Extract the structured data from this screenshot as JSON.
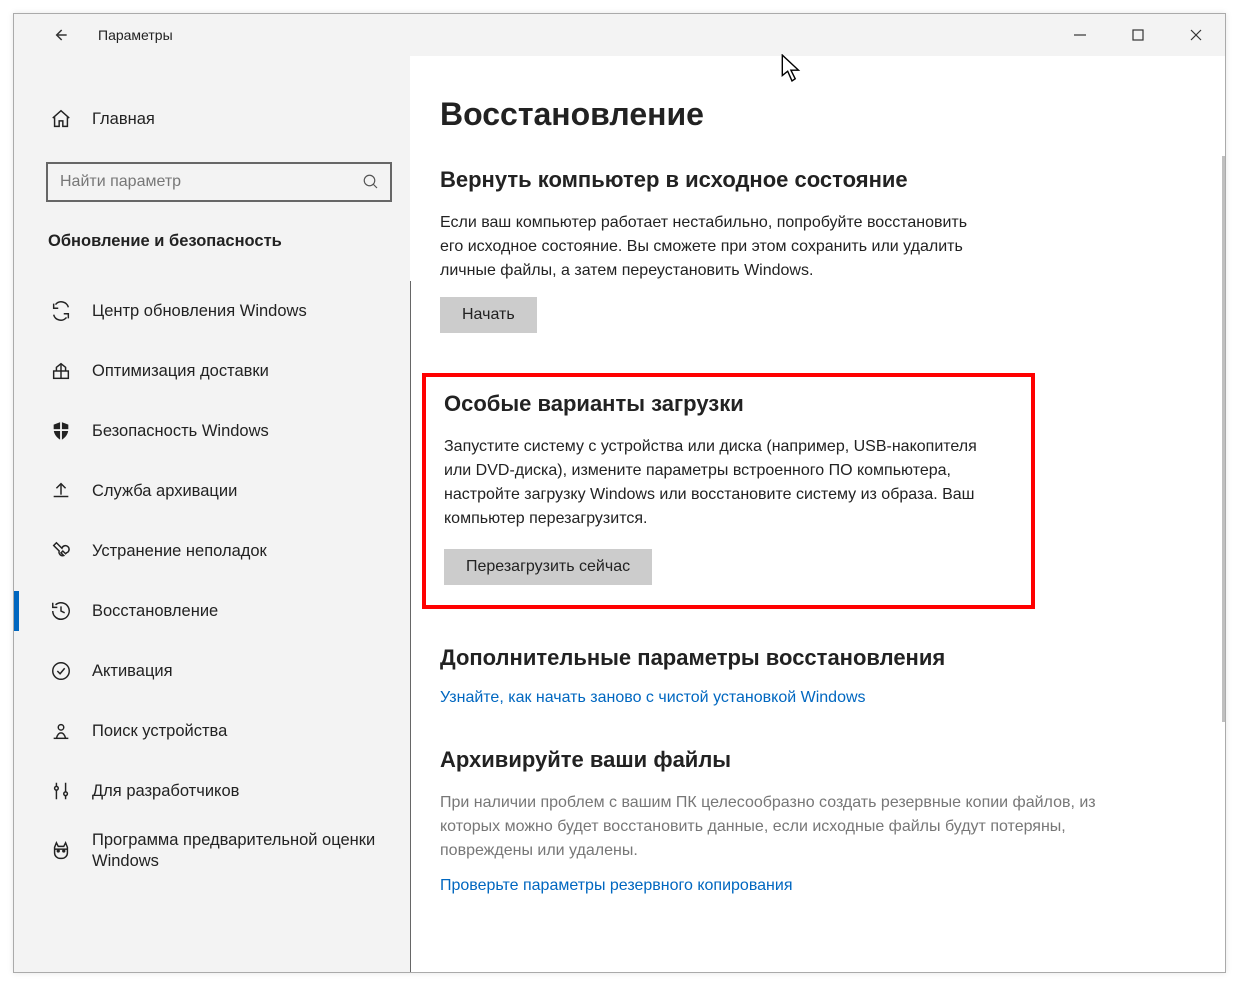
{
  "window": {
    "title": "Параметры"
  },
  "sidebar": {
    "home": "Главная",
    "search_placeholder": "Найти параметр",
    "section": "Обновление и безопасность",
    "items": [
      {
        "label": "Центр обновления Windows"
      },
      {
        "label": "Оптимизация доставки"
      },
      {
        "label": "Безопасность Windows"
      },
      {
        "label": "Служба архивации"
      },
      {
        "label": "Устранение неполадок"
      },
      {
        "label": "Восстановление"
      },
      {
        "label": "Активация"
      },
      {
        "label": "Поиск устройства"
      },
      {
        "label": "Для разработчиков"
      },
      {
        "label": "Программа предварительной оценки Windows"
      }
    ]
  },
  "main": {
    "title": "Восстановление",
    "reset": {
      "heading": "Вернуть компьютер в исходное состояние",
      "desc": "Если ваш компьютер работает нестабильно, попробуйте восстановить его исходное состояние. Вы сможете при этом сохранить или удалить личные файлы, а затем переустановить Windows.",
      "button": "Начать"
    },
    "advanced_startup": {
      "heading": "Особые варианты загрузки",
      "desc": "Запустите систему с устройства или диска (например, USB-накопителя или DVD-диска), измените параметры встроенного ПО компьютера, настройте загрузку Windows или восстановите систему из образа. Ваш компьютер перезагрузится.",
      "button": "Перезагрузить сейчас"
    },
    "more_recovery": {
      "heading": "Дополнительные параметры восстановления",
      "link": "Узнайте, как начать заново с чистой установкой Windows"
    },
    "backup": {
      "heading": "Архивируйте ваши файлы",
      "desc": "При наличии проблем с вашим ПК целесообразно создать резервные копии файлов, из которых можно будет восстановить данные, если исходные файлы будут потеряны, повреждены или удалены.",
      "link": "Проверьте параметры резервного копирования"
    }
  }
}
